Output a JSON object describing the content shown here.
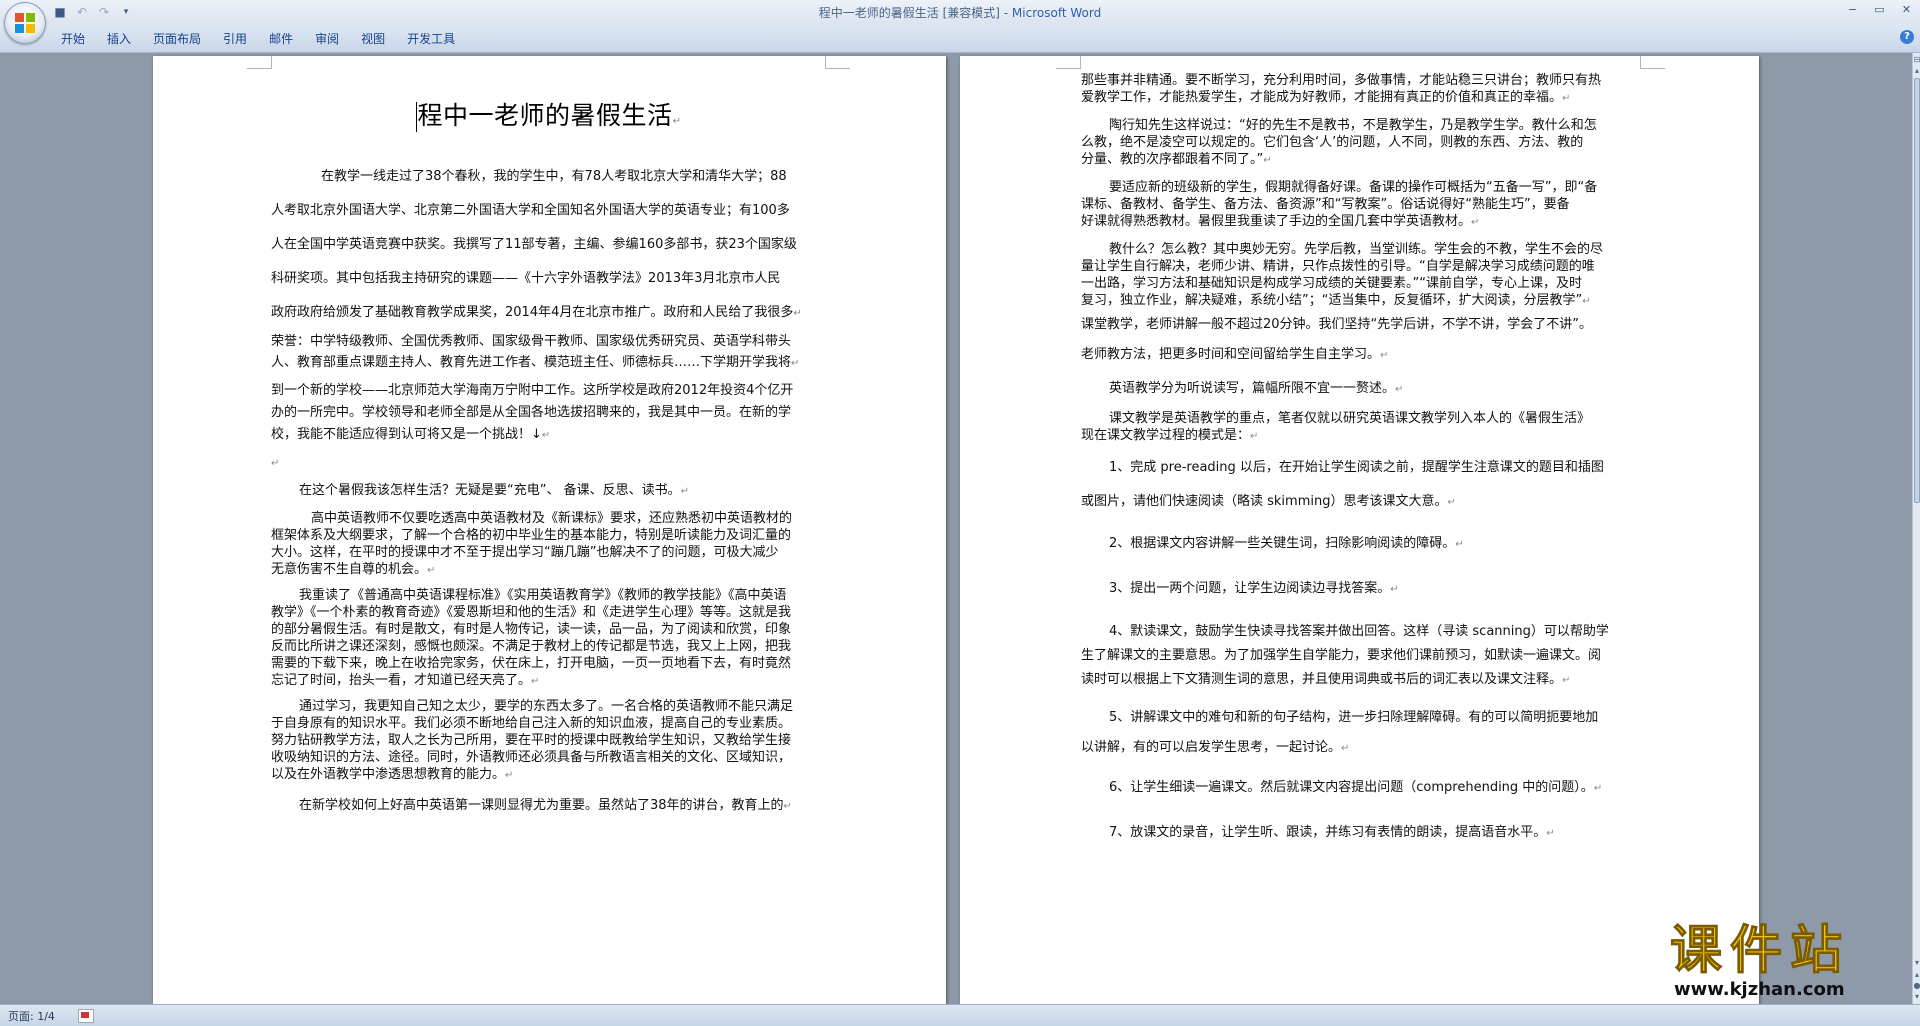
{
  "window": {
    "title": "程中一老师的暑假生活 [兼容模式] - ",
    "app_name": "Microsoft Word",
    "controls": [
      "−",
      "▭",
      "✕"
    ]
  },
  "quick_access": [
    "save-icon",
    "undo-icon",
    "redo-icon",
    "customize-icon"
  ],
  "ribbon": {
    "tabs": [
      "开始",
      "插入",
      "页面布局",
      "引用",
      "邮件",
      "审阅",
      "视图",
      "开发工具"
    ],
    "help": "?"
  },
  "document": {
    "title": "程中一老师的暑假生活",
    "page1": [
      {
        "indent": 50,
        "lines": [
          "在教学一线走过了38个春秋，我的学生中，有78人考取北京大学和清华大学；88",
          "人考取北京外国语大学、北京第二外国语大学和全国知名外国语大学的英语专业；有100多",
          "人在全国中学英语竞赛中获奖。我撰写了11部专著，主编、参编160多部书，获23个国家级",
          "科研奖项。其中包括我主持研究的课题——《十六字外语教学法》2013年3月北京市人民",
          "政府政府给颁发了基础教育教学成果奖，2014年4月在北京市推广。政府和人民给了我很多"
        ]
      },
      {
        "indent": 0,
        "lines": [
          "荣誉：中学特级教师、全国优秀教师、国家级骨干教师、国家级优秀研究员、英语学科带头",
          "人、教育部重点课题主持人、教育先进工作者、模范班主任、师德标兵……下学期开学我将"
        ]
      },
      {
        "indent": 0,
        "lines": [
          "到一个新的学校——北京师范大学海南万宁附中工作。这所学校是政府2012年投资4个亿开",
          "办的一所完中。学校领导和老师全部是从全国各地选拔招聘来的，我是其中一员。在新的学",
          "校，我能不能适应得到认可将又是一个挑战！↓"
        ]
      },
      {
        "indent": 0,
        "lines": [
          ""
        ]
      },
      {
        "indent": 28,
        "lines": [
          "在这个暑假我该怎样生活？无疑是要“充电”、 备课、反思、读书。"
        ]
      },
      {
        "indent": 40,
        "lines": [
          "高中英语教师不仅要吃透高中英语教材及《新课标》要求，还应熟悉初中英语教材的",
          "框架体系及大纲要求，了解一个合格的初中毕业生的基本能力，特别是听读能力及词汇量的",
          "大小。这样，在平时的授课中才不至于提出学习“蹦几蹦”也解决不了的问题，可极大减少",
          "无意伤害不生自尊的机会。"
        ]
      },
      {
        "indent": 28,
        "lines": [
          "我重读了《普通高中英语课程标准》《实用英语教育学》《教师的教学技能》《高中英语",
          "教学》《一个朴素的教育奇迹》《爱恩斯坦和他的生活》和《走进学生心理》等等。这就是我",
          "的部分暑假生活。有时是散文，有时是人物传记，读一读，品一品，为了阅读和欣赏，印象",
          "反而比所讲之课还深刻，感慨也颇深。不满足于教材上的传记都是节选，我又上上网，把我",
          "需要的下载下来，晚上在收拾完家务，伏在床上，打开电脑，一页一页地看下去，有时竟然",
          "忘记了时间，抬头一看，才知道已经天亮了。"
        ]
      },
      {
        "indent": 28,
        "lines": [
          "通过学习，我更知自己知之太少，要学的东西太多了。一名合格的英语教师不能只满足",
          "于自身原有的知识水平。我们必须不断地给自己注入新的知识血液，提高自己的专业素质。",
          "努力钻研教学方法，取人之长为己所用，要在平时的授课中既教给学生知识，又教给学生接",
          "收吸纳知识的方法、途径。同时，外语教师还必须具备与所教语言相关的文化、区域知识，",
          "以及在外语教学中渗透思想教育的能力。"
        ]
      },
      {
        "indent": 28,
        "lines": [
          "在新学校如何上好高中英语第一课则显得尤为重要。虽然站了38年的讲台，教育上的"
        ]
      }
    ],
    "page2": [
      {
        "indent": 0,
        "lines": [
          "那些事并非精通。要不断学习，充分利用时间，多做事情，才能站稳三只讲台；教师只有热",
          "爱教学工作，才能热爱学生，才能成为好教师，才能拥有真正的价值和真正的幸福。"
        ]
      },
      {
        "indent": 28,
        "lines": [
          "陶行知先生这样说过：“好的先生不是教书，不是教学生，乃是教学生学。教什么和怎",
          "么教，绝不是凌空可以规定的。它们包含‘人’的问题，人不同，则教的东西、方法、教的",
          "分量、教的次序都跟着不同了。”"
        ]
      },
      {
        "indent": 28,
        "lines": [
          "要适应新的班级新的学生，假期就得备好课。备课的操作可概括为“五备一写”，即“备",
          "课标、备教材、备学生、备方法、备资源”和“写教案”。俗话说得好“熟能生巧”，要备",
          "好课就得熟悉教材。暑假里我重读了手边的全国几套中学英语教材。"
        ]
      },
      {
        "indent": 28,
        "lines": [
          "教什么？怎么教？其中奥妙无穷。先学后教，当堂训练。学生会的不教，学生不会的尽",
          "量让学生自行解决，老师少讲、精讲，只作点拨性的引导。“自学是解决学习成绩问题的唯",
          "一出路，学习方法和基础知识是构成学习成绩的关键要素。”“课前自学，专心上课，及时",
          "复习，独立作业，解决疑难，系统小结”；“适当集中，反复循环，扩大阅读，分层教学”"
        ]
      },
      {
        "indent": 0,
        "lines": [
          "课堂教学，老师讲解一般不超过20分钟。我们坚持“先学后讲，不学不讲，学会了不讲”。",
          "老师教方法，把更多时间和空间留给学生自主学习。"
        ]
      },
      {
        "indent": 28,
        "lines": [
          "英语教学分为听说读写，篇幅所限不宜一一赘述。"
        ]
      },
      {
        "indent": 28,
        "lines": [
          "课文教学是英语教学的重点，笔者仅就以研究英语课文教学列入本人的《暑假生活》",
          "现在课文教学过程的模式是："
        ]
      },
      {
        "indent": 28,
        "lines": [
          "1、完成 pre-reading 以后，在开始让学生阅读之前，提醒学生注意课文的题目和插图",
          "或图片，请他们快速阅读（略读 skimming）思考该课文大意。"
        ]
      },
      {
        "indent": 28,
        "lines": [
          "2、根据课文内容讲解一些关键生词，扫除影响阅读的障碍。"
        ]
      },
      {
        "indent": 28,
        "lines": [
          "3、提出一两个问题，让学生边阅读边寻找答案。"
        ]
      },
      {
        "indent": 28,
        "lines": [
          "4、默读课文，鼓励学生快读寻找答案并做出回答。这样（寻读 scanning）可以帮助学",
          "生了解课文的主要意思。为了加强学生自学能力，要求他们课前预习，如默读一遍课文。阅",
          "读时可以根据上下文猜测生词的意思，并且使用词典或书后的词汇表以及课文注释。"
        ]
      },
      {
        "indent": 28,
        "lines": [
          "5、讲解课文中的难句和新的句子结构，进一步扫除理解障碍。有的可以简明扼要地加",
          "以讲解，有的可以启发学生思考，一起讨论。"
        ]
      },
      {
        "indent": 28,
        "lines": [
          "6、让学生细读一遍课文。然后就课文内容提出问题（comprehending 中的问题）。"
        ]
      },
      {
        "indent": 28,
        "lines": [
          "7、放课文的录音，让学生听、跟读，并练习有表情的朗读，提高语音水平。"
        ]
      }
    ]
  },
  "status": {
    "page_indicator": "页面: 1/4"
  },
  "watermark": {
    "title": "课件站",
    "url": "www.kjzhan.com"
  }
}
